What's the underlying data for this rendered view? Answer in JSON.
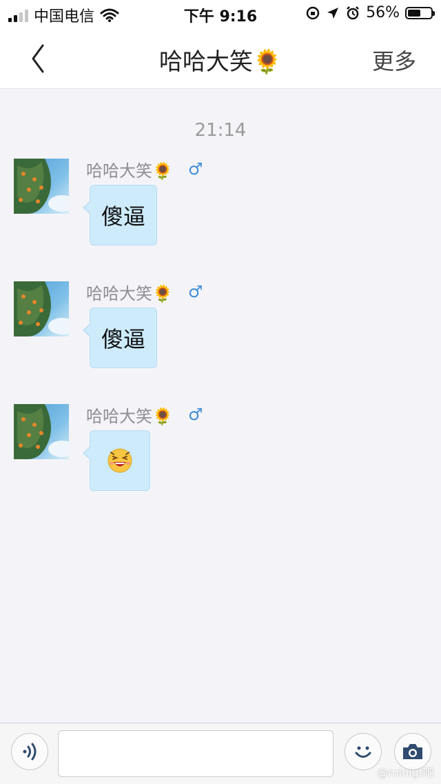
{
  "status_bar": {
    "carrier": "中国电信",
    "time": "下午 9:16",
    "battery_percent": "56%",
    "battery_level": 0.56
  },
  "nav": {
    "back_icon": "chevron-left-icon",
    "title": "哈哈大笑🌻",
    "more_label": "更多"
  },
  "chat": {
    "time_label": "21:14",
    "messages": [
      {
        "sender": "哈哈大笑🌻",
        "gender_symbol": "♂",
        "text": "傻逼"
      },
      {
        "sender": "哈哈大笑🌻",
        "gender_symbol": "♂",
        "text": "傻逼"
      },
      {
        "sender": "哈哈大笑🌻",
        "gender_symbol": "♂",
        "emoji": "laughing-face-icon"
      }
    ]
  },
  "input_bar": {
    "voice_icon": "voice-icon",
    "emoji_icon": "smiley-icon",
    "camera_icon": "camera-icon"
  },
  "watermark": "@minigt吧",
  "colors": {
    "bubble": "#cdebfb",
    "male_symbol": "#3f8ed8",
    "background": "#f4f4f8"
  }
}
